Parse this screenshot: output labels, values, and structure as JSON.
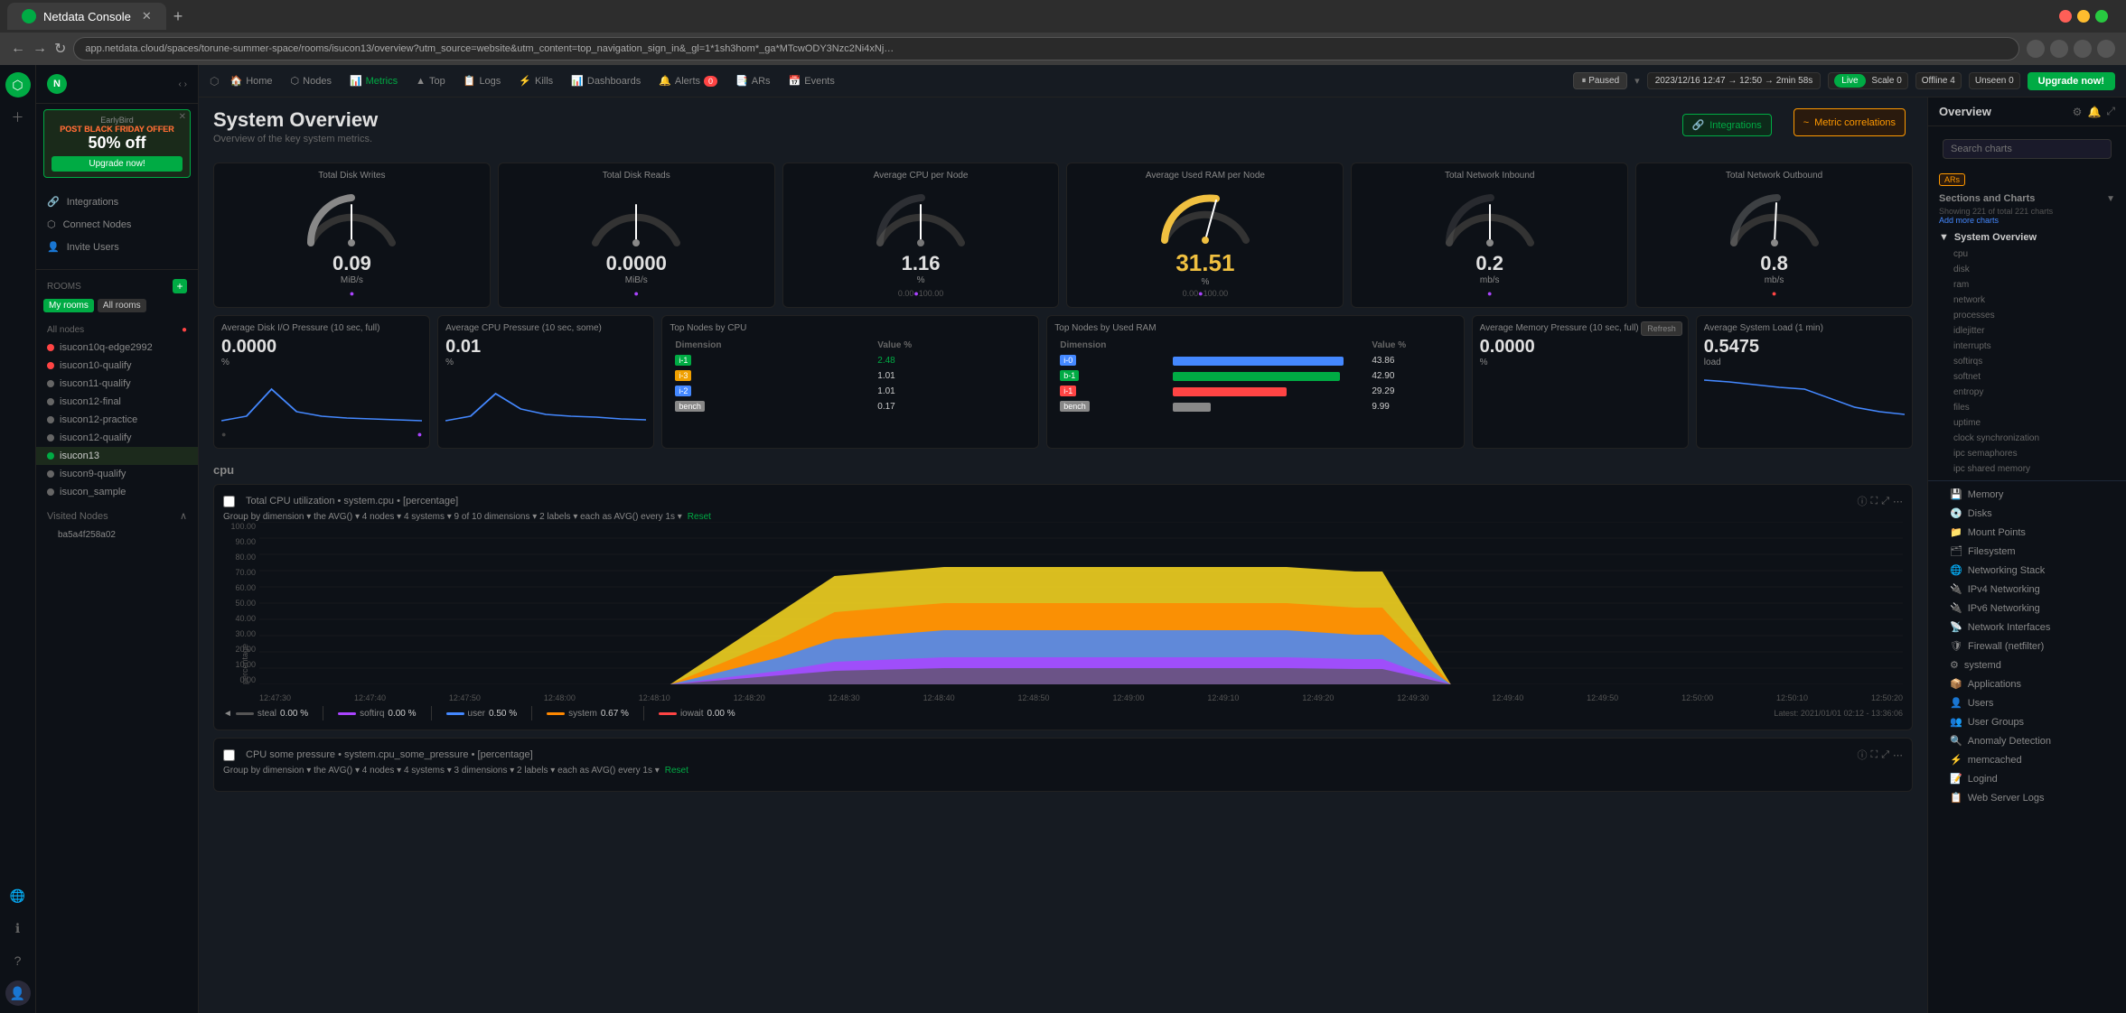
{
  "browser": {
    "tab_title": "Netdata Console",
    "tab_favicon": "N",
    "address": "app.netdata.cloud/spaces/torune-summer-space/rooms/isucon13/overview?utm_source=website&utm_content=top_navigation_sign_in&_gl=1*1sh3hom*_ga*MTcwODY3Nzc2Ni4xNjk5MDE3Mjk5*_ga_J69ZZJCTFB*MTcwMjY5Njg4Ny4xNS...",
    "new_tab_label": "+",
    "nav_back": "←",
    "nav_forward": "→",
    "nav_refresh": "↻",
    "nav_home": "⌂"
  },
  "header": {
    "space_name": "Torune summer space",
    "room_name": "isucon13",
    "home_label": "Home",
    "nodes_label": "Nodes",
    "metrics_label": "Metrics",
    "top_label": "Top",
    "logs_label": "Logs",
    "kills_label": "Kills",
    "dashboards_label": "Dashboards",
    "alerts_label": "Alerts",
    "alert_count": "0",
    "ars_label": "ARs",
    "events_label": "Events",
    "paused_label": "Paused",
    "time_range": "2023/12/16 12:47 → 12:50",
    "duration": "2min 58s",
    "live_label": "Live",
    "scale_label": "Scale",
    "scale_value": "0",
    "offline_label": "Offline",
    "offline_count": "4",
    "unseen_label": "Unseen",
    "unseen_count": "0",
    "upgrade_label": "Upgrade now!",
    "integrations_label": "Integrations",
    "metric_correlations_label": "Metric correlations"
  },
  "sidebar": {
    "earlybird_label": "EarlyBird",
    "post_black_friday": "POST BLACK FRIDAY OFFER",
    "discount": "50% off",
    "upgrade_btn": "Upgrade now!",
    "nav_items": [
      {
        "id": "integrations",
        "label": "Integrations",
        "icon": "🔗"
      },
      {
        "id": "connect-nodes",
        "label": "Connect Nodes",
        "icon": "⬡"
      },
      {
        "id": "invite-users",
        "label": "Invite Users",
        "icon": "👤"
      }
    ],
    "rooms_label": "Rooms",
    "my_rooms_btn": "My rooms",
    "all_rooms_btn": "All rooms",
    "all_nodes_label": "All nodes",
    "nodes": [
      {
        "id": "isucon10q-edge2992",
        "label": "isucon10q-edge2992",
        "status": "red"
      },
      {
        "id": "isucon10-qualify",
        "label": "isucon10-qualify",
        "status": "red"
      },
      {
        "id": "isucon11-qualify",
        "label": "isucon11-qualify",
        "status": "default"
      },
      {
        "id": "isucon12-final",
        "label": "isucon12-final",
        "status": "default"
      },
      {
        "id": "isucon12-practice",
        "label": "isucon12-practice",
        "status": "default"
      },
      {
        "id": "isucon12-qualify",
        "label": "isucon12-qualify",
        "status": "default"
      },
      {
        "id": "isucon13",
        "label": "isucon13",
        "status": "green",
        "active": true
      },
      {
        "id": "isucon9-qualify",
        "label": "isucon9-qualify",
        "status": "default"
      },
      {
        "id": "isucon_sample",
        "label": "isucon_sample",
        "status": "default"
      }
    ],
    "visited_nodes_label": "Visited Nodes",
    "visited_nodes": [
      {
        "id": "ba5a4f258a02",
        "label": "ba5a4f258a02"
      }
    ]
  },
  "dashboard": {
    "title": "System Overview",
    "subtitle": "Overview of the key system metrics.",
    "gauges": [
      {
        "id": "total-disk-writes",
        "title": "Total Disk Writes",
        "value": "0.09",
        "unit": "MiB/s",
        "arc_color": "#888",
        "needle_value": 0.09
      },
      {
        "id": "total-disk-reads",
        "title": "Total Disk Reads",
        "value": "0.0000",
        "unit": "MiB/s",
        "arc_color": "#888",
        "needle_value": 0
      },
      {
        "id": "average-cpu-per-node",
        "title": "Average CPU per Node",
        "value": "1.16",
        "unit": "%",
        "arc_color": "#555",
        "needle_value": 1.16
      },
      {
        "id": "average-used-ram",
        "title": "Average Used RAM per Node",
        "value": "31.51",
        "unit": "%",
        "arc_color": "#f0c040",
        "needle_value": 31.51
      },
      {
        "id": "total-network-inbound",
        "title": "Total Network Inbound",
        "value": "0.2",
        "unit": "mb/s",
        "arc_color": "#888",
        "needle_value": 0.2
      },
      {
        "id": "total-network-outbound",
        "title": "Total Network Outbound",
        "value": "0.8",
        "unit": "mb/s",
        "arc_color": "#888",
        "needle_value": 0.8
      }
    ],
    "chart_cards": [
      {
        "id": "avg-disk-io",
        "title": "Average Disk I/O Pressure (10 sec, full)",
        "value": "0.0000",
        "unit": "%"
      },
      {
        "id": "avg-cpu-pressure",
        "title": "Average CPU Pressure (10 sec, some)",
        "value": "0.01",
        "unit": "%"
      },
      {
        "id": "top-nodes-cpu",
        "title": "Top Nodes by CPU",
        "columns": [
          "Dimension",
          "Value %"
        ],
        "rows": [
          {
            "dim": "i-1",
            "color": "#00ab44",
            "value": "2.48"
          },
          {
            "dim": "i-3",
            "color": "#f0a000",
            "value": "1.01"
          },
          {
            "dim": "i-2",
            "color": "#4488ff",
            "value": "1.01"
          },
          {
            "dim": "bench",
            "color": "#888",
            "value": "0.17"
          }
        ]
      },
      {
        "id": "top-nodes-ram",
        "title": "Top Nodes by Used RAM",
        "columns": [
          "Dimension",
          "Value %"
        ],
        "rows": [
          {
            "dim": "i-0",
            "color": "#4488ff",
            "value": "43.86"
          },
          {
            "dim": "b-1",
            "color": "#00ab44",
            "value": "42.90"
          },
          {
            "dim": "i-1",
            "color": "#ff4444",
            "value": "29.29"
          },
          {
            "dim": "bench",
            "color": "#888",
            "value": "9.99"
          }
        ]
      },
      {
        "id": "avg-memory-pressure",
        "title": "Average Memory Pressure (10 sec, full)",
        "value": "0.0000",
        "unit": "%",
        "has_refresh": true
      },
      {
        "id": "avg-system-load",
        "title": "Average System Load (1 min)",
        "value": "0.5475",
        "unit": "load"
      }
    ],
    "cpu_section": {
      "title": "cpu",
      "chart1_title": "Total CPU utilization • system.cpu • [percentage]",
      "chart1_group": "Group by dimension ▾  the AVG() ▾  4 nodes ▾  4 systems ▾  9 of 10 dimensions ▾  2 labels ▾  each as AVG() every 1s ▾",
      "chart1_reset": "Reset",
      "y_labels": [
        "100.00",
        "90.00",
        "80.00",
        "70.00",
        "60.00",
        "50.00",
        "40.00",
        "30.00",
        "20.00",
        "10.00",
        "0.00"
      ],
      "y_axis_label": "percentage",
      "x_labels": [
        "12:47:30",
        "12:47:40",
        "12:47:50",
        "12:48:00",
        "12:48:10",
        "12:48:20",
        "12:48:30",
        "12:48:40",
        "12:48:50",
        "12:49:00",
        "12:49:10",
        "12:49:20",
        "12:49:30",
        "12:49:40",
        "12:49:50",
        "12:50:00",
        "12:50:10",
        "12:50:20"
      ],
      "legend": [
        {
          "name": "steal",
          "color": "#888",
          "value": "0.00 %"
        },
        {
          "name": "softirq",
          "color": "#aa44ff",
          "value": "0.00 %"
        },
        {
          "name": "user",
          "color": "#4488ff",
          "value": "0.50 %"
        },
        {
          "name": "system",
          "color": "#ff8800",
          "value": "0.67 %"
        },
        {
          "name": "iowait",
          "color": "#ff4444",
          "value": "0.00 %"
        }
      ],
      "chart2_title": "CPU some pressure • system.cpu_some_pressure • [percentage]",
      "chart2_group": "Group by dimension ▾  the AVG() ▾  4 nodes ▾  4 systems ▾  3 dimensions ▾  2 labels ▾  each as AVG() every 1s ▾",
      "chart2_reset": "Reset"
    }
  },
  "right_sidebar": {
    "title": "Overview",
    "search_placeholder": "Search charts",
    "showing_text": "Showing 221 of total 221 charts",
    "add_more_label": "Add more charts",
    "arn_badge": "ARs",
    "sections_and_charts_label": "Sections and Charts",
    "main_section": "System Overview",
    "sub_sections": [
      "cpu",
      "disk",
      "ram",
      "network",
      "processes",
      "idlejitter",
      "interrupts",
      "softirqs",
      "softnet",
      "entropy",
      "files",
      "uptime",
      "clock synchronization",
      "ipc semaphores",
      "ipc shared memory"
    ],
    "section_groups": [
      {
        "id": "memory",
        "label": "Memory",
        "icon": "💾"
      },
      {
        "id": "disks",
        "label": "Disks",
        "icon": "💿"
      },
      {
        "id": "mount-points",
        "label": "Mount Points",
        "icon": "📁"
      },
      {
        "id": "filesystem",
        "label": "Filesystem",
        "icon": "🗂"
      },
      {
        "id": "networking-stack",
        "label": "Networking Stack",
        "icon": "🌐"
      },
      {
        "id": "ipv4-networking",
        "label": "IPv4 Networking",
        "icon": "🔌"
      },
      {
        "id": "ipv6-networking",
        "label": "IPv6 Networking",
        "icon": "🔌"
      },
      {
        "id": "network-interfaces",
        "label": "Network Interfaces",
        "icon": "📡"
      },
      {
        "id": "firewall",
        "label": "Firewall (netfilter)",
        "icon": "🛡"
      },
      {
        "id": "systemd",
        "label": "systemd",
        "icon": "⚙"
      },
      {
        "id": "applications",
        "label": "Applications",
        "icon": "📦"
      },
      {
        "id": "users",
        "label": "Users",
        "icon": "👤"
      },
      {
        "id": "user-groups",
        "label": "User Groups",
        "icon": "👥"
      },
      {
        "id": "anomaly-detection",
        "label": "Anomaly Detection",
        "icon": "🔍"
      },
      {
        "id": "memcached",
        "label": "memcached",
        "icon": "⚡"
      },
      {
        "id": "logind",
        "label": "Logind",
        "icon": "📝"
      },
      {
        "id": "web-server-logs",
        "label": "Web Server Logs",
        "icon": "📋"
      }
    ]
  }
}
